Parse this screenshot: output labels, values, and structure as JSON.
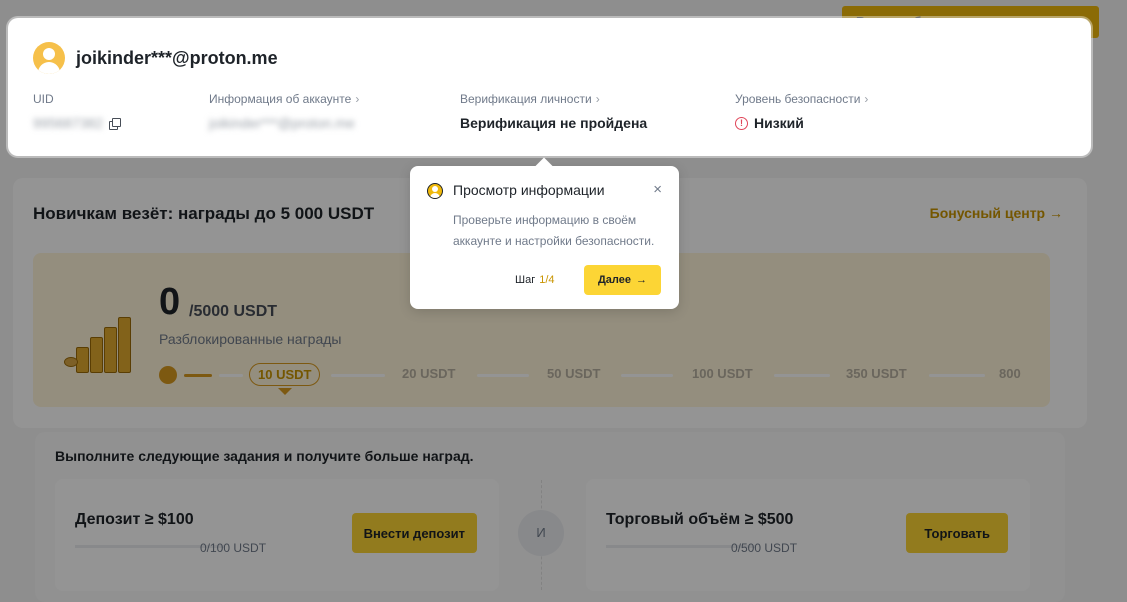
{
  "account": {
    "email": "joikinder***@proton.me",
    "uid_label": "UID",
    "uid_value": "995687382",
    "account_info_label": "Информация об аккаунте",
    "account_info_value": "joikinder***@proton.me",
    "verification_label": "Верификация личности",
    "verification_value": "Верификация не пройдена",
    "security_label": "Уровень безопасности",
    "security_value": "Низкий",
    "chevron": "›"
  },
  "banner_peek": "Ваш дашборд находится здесь",
  "rewards": {
    "title": "Новичкам везёт: награды до 5 000 USDT",
    "bonus_center_label": "Бонусный центр",
    "bonus_center_arrow": "→",
    "unlocked_amount": "0",
    "total": "/5000 USDT",
    "unlocked_label": "Разблокированные награды",
    "milestones": [
      "10 USDT",
      "20 USDT",
      "50 USDT",
      "100 USDT",
      "350 USDT",
      "800"
    ]
  },
  "tasks": {
    "title": "Выполните следующие задания и получите больше наград.",
    "and_label": "И",
    "deposit": {
      "title": "Депозит ≥ $100",
      "progress": "0/100 USDT",
      "button": "Внести депозит"
    },
    "trade": {
      "title": "Торговый объём ≥ $500",
      "progress": "0/500 USDT",
      "button": "Торговать"
    }
  },
  "popup": {
    "title": "Просмотр информации",
    "description": "Проверьте информацию в своём аккаунте и настройки безопасности.",
    "step_label": "Шаг",
    "step_value": "1/4",
    "next_button": "Далее",
    "next_arrow": "→",
    "close": "×"
  },
  "colors": {
    "accent": "#fcd535",
    "brand_gold": "#c99400",
    "danger": "#e04559"
  }
}
